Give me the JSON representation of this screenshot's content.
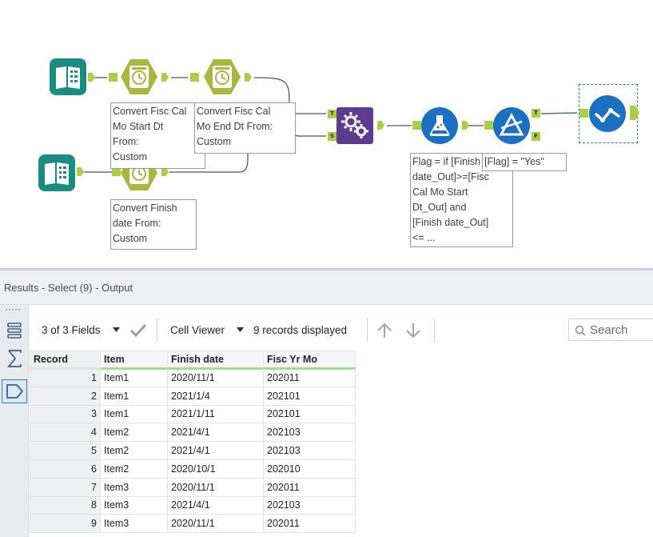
{
  "canvas": {
    "annotations": {
      "convert_start": "Convert Fisc Cal\nMo Start Dt\nFrom:\nCustom",
      "convert_end": "Convert Fisc Cal\nMo End Dt From:\nCustom",
      "convert_finish": "Convert Finish\ndate From:\nCustom",
      "formula": "Flag = if [Finish\ndate_Out]>=[Fisc\nCal Mo Start\nDt_Out] and\n[Finish date_Out]\n<= ...",
      "filter": "[Flag] = \"Yes\""
    },
    "anchor_labels": {
      "join_left": "T",
      "join_right": "S",
      "filter_true": "T",
      "filter_false": "F"
    },
    "colors": {
      "input_teal": "#1a8d82",
      "datetime_olive": "#a9b83c",
      "join_purple": "#5d3b8e",
      "formula_blue": "#1b70c1",
      "filter_blue": "#1b70c1",
      "browse_blue": "#1b70c1",
      "anchor_green": "#a8cf45"
    },
    "icons": [
      "book-input-icon",
      "clock-datetime-icon",
      "gears-join-icon",
      "flask-formula-icon",
      "triangle-filter-icon",
      "check-browse-icon"
    ]
  },
  "results": {
    "title": "Results - Select (9) - Output",
    "toolbar": {
      "fields_label": "3 of 3 Fields",
      "cell_viewer_label": "Cell Viewer",
      "records_label": "9 records displayed",
      "search_placeholder": "Search"
    },
    "table": {
      "columns": [
        "Record",
        "Item",
        "Finish date",
        "Fisc Yr Mo"
      ],
      "rows": [
        [
          "1",
          "Item1",
          "2020/11/1",
          "202011"
        ],
        [
          "2",
          "Item1",
          "2021/1/4",
          "202101"
        ],
        [
          "3",
          "Item1",
          "2021/1/11",
          "202101"
        ],
        [
          "4",
          "Item2",
          "2021/4/1",
          "202103"
        ],
        [
          "5",
          "Item2",
          "2021/4/1",
          "202103"
        ],
        [
          "6",
          "Item2",
          "2020/10/1",
          "202010"
        ],
        [
          "7",
          "Item3",
          "2020/11/1",
          "202011"
        ],
        [
          "8",
          "Item3",
          "2021/4/1",
          "202103"
        ],
        [
          "9",
          "Item3",
          "2020/11/1",
          "202011"
        ]
      ]
    }
  }
}
